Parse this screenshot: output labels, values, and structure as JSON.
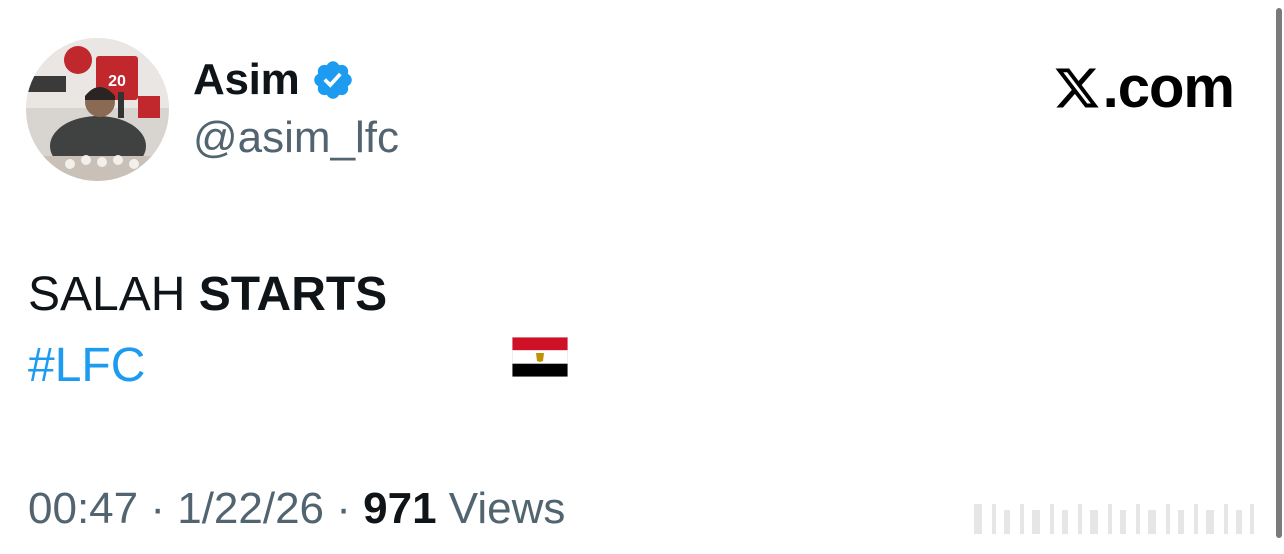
{
  "author": {
    "display_name": "Asim",
    "handle": "@asim_lfc",
    "verified": true,
    "verified_color": "#1d9bf0",
    "avatar_icon": "avatar-photo"
  },
  "site": {
    "logo_icon": "x-logo-icon",
    "label": ".com"
  },
  "tweet": {
    "text_plain": "SALAH ",
    "text_bold": "STARTS",
    "emoji": "egypt-flag-emoji",
    "hashtag": "#LFC",
    "hashtag_color": "#1d9bf0"
  },
  "meta": {
    "time": "00:47",
    "sep1": " · ",
    "date": "1/22/26",
    "sep2": " · ",
    "views_count": "971",
    "views_label": " Views"
  }
}
